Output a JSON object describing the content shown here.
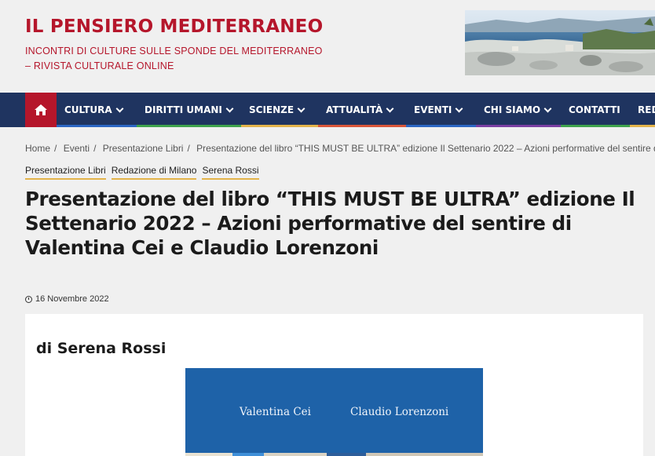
{
  "site": {
    "title": "IL PENSIERO MEDITERRANEO",
    "tagline": "INCONTRI DI CULTURE SULLE SPONDE DEL MEDITERRANEO – RIVISTA CULTURALE ONLINE"
  },
  "nav": {
    "home_icon": "home-icon",
    "items": [
      {
        "label": "CULTURA",
        "dropdown": true,
        "underline": "#2b66c4"
      },
      {
        "label": "DIRITTI UMANI",
        "dropdown": true,
        "underline": "#3fa34d"
      },
      {
        "label": "SCIENZE",
        "dropdown": true,
        "underline": "#e3b34a"
      },
      {
        "label": "ATTUALITÀ",
        "dropdown": true,
        "underline": "#d9563a"
      },
      {
        "label": "EVENTI",
        "dropdown": true,
        "underline": "#2b66c4"
      },
      {
        "label": "CHI SIAMO",
        "dropdown": true,
        "underline": "#7a3fa3"
      },
      {
        "label": "CONTATTI",
        "dropdown": false,
        "underline": "#3fa34d"
      },
      {
        "label": "RED",
        "dropdown": false,
        "underline": "#e3b34a"
      }
    ]
  },
  "breadcrumb": [
    "Home",
    "Eventi",
    "Presentazione Libri",
    "Presentazione del libro “THIS MUST BE ULTRA” edizione Il Settenario 2022 – Azioni performative del sentire di Valen"
  ],
  "tags": [
    "Presentazione Libri",
    "Redazione di Milano",
    "Serena Rossi"
  ],
  "post": {
    "title": "Presentazione del libro “THIS MUST BE ULTRA” edizione Il Settenario 2022 – Azioni performative del sentire di Valentina Cei e Claudio Lorenzoni",
    "date": "16 Novembre 2022",
    "byline": "di Serena Rossi",
    "cover_authors": [
      "Valentina Cei",
      "Claudio Lorenzoni"
    ]
  },
  "colors": {
    "brand_red": "#b5162b",
    "nav_blue": "#1f3460",
    "cover_blue": "#1e62a8"
  }
}
